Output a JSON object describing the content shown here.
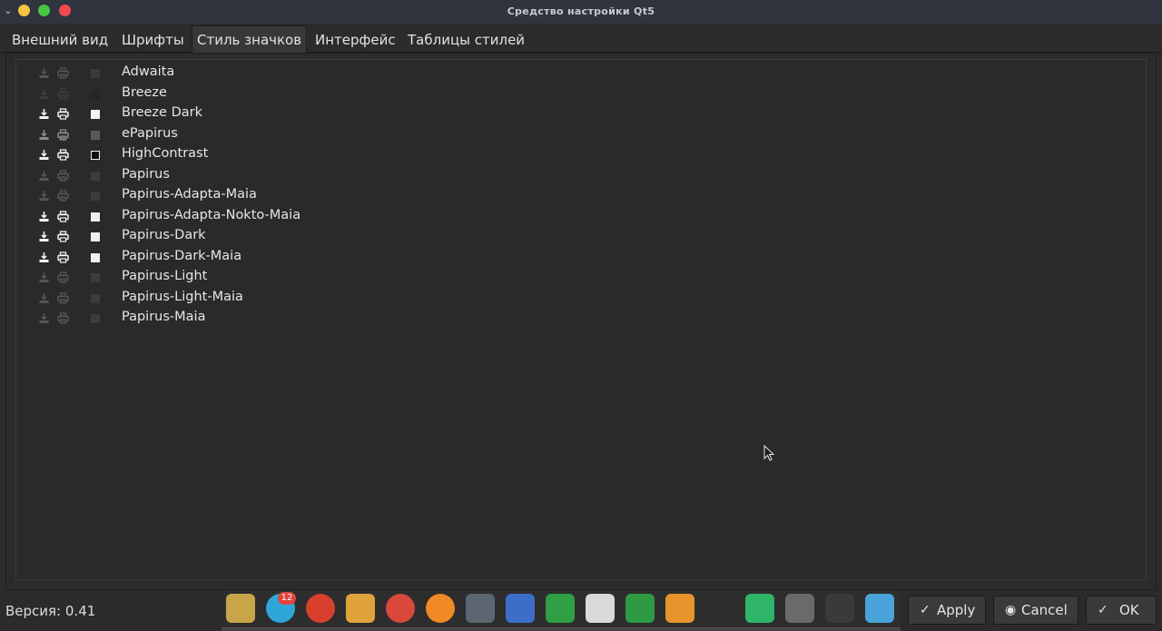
{
  "window": {
    "title": "Средство настройки Qt5"
  },
  "tabs": [
    {
      "label": "Внешний вид"
    },
    {
      "label": "Шрифты"
    },
    {
      "label": "Стиль значков"
    },
    {
      "label": "Интерфейс"
    },
    {
      "label": "Таблицы стилей"
    }
  ],
  "active_tab": "Стиль значков",
  "themes": [
    {
      "name": "Adwaita",
      "icon_style": "dim",
      "swatch": "#3a3a3a"
    },
    {
      "name": "Breeze",
      "icon_style": "dark",
      "swatch": "#232629"
    },
    {
      "name": "Breeze Dark",
      "icon_style": "light",
      "swatch": "#f4f4f4"
    },
    {
      "name": "ePapirus",
      "icon_style": "grey",
      "swatch": "#5a5a5a"
    },
    {
      "name": "HighContrast",
      "icon_style": "light",
      "swatch": "outline"
    },
    {
      "name": "Papirus",
      "icon_style": "dim",
      "swatch": "#3c3c3c"
    },
    {
      "name": "Papirus-Adapta-Maia",
      "icon_style": "dim",
      "swatch": "#3c3c3c"
    },
    {
      "name": "Papirus-Adapta-Nokto-Maia",
      "icon_style": "light",
      "swatch": "#eeeeee"
    },
    {
      "name": "Papirus-Dark",
      "icon_style": "light",
      "swatch": "#eeeeee"
    },
    {
      "name": "Papirus-Dark-Maia",
      "icon_style": "light",
      "swatch": "#eeeeee"
    },
    {
      "name": "Papirus-Light",
      "icon_style": "dim",
      "swatch": "#3c3c3c"
    },
    {
      "name": "Papirus-Light-Maia",
      "icon_style": "dim",
      "swatch": "#3c3c3c"
    },
    {
      "name": "Papirus-Maia",
      "icon_style": "dim",
      "swatch": "#3c3c3c"
    }
  ],
  "footer": {
    "version": "Версия: 0.41",
    "apply_label": "Apply",
    "cancel_label": "Cancel",
    "ok_label": "OK"
  },
  "dock": {
    "telegram_badge": "12",
    "apps": [
      {
        "name": "archive-manager-icon",
        "color": "#c9a54a"
      },
      {
        "name": "telegram-icon",
        "color": "#2ea6da"
      },
      {
        "name": "doublecmd-icon",
        "color": "#d8402d"
      },
      {
        "name": "bleachbit-icon",
        "color": "#e0a23a"
      },
      {
        "name": "stacer-icon",
        "color": "#d9483b"
      },
      {
        "name": "firefox-icon",
        "color": "#f08a24"
      },
      {
        "name": "calculator-icon",
        "color": "#5c6670"
      },
      {
        "name": "writer-icon",
        "color": "#3c6ec8"
      },
      {
        "name": "calc-icon",
        "color": "#2f9e44"
      },
      {
        "name": "pdf-icon",
        "color": "#d9d9d9"
      },
      {
        "name": "vim-icon",
        "color": "#2e9a44"
      },
      {
        "name": "sublime-text-icon",
        "color": "#e8932c"
      },
      {
        "name": "pycharm-icon",
        "color": "#2d2d2d"
      },
      {
        "name": "system-monitor-icon",
        "color": "#2fb56a"
      },
      {
        "name": "trash-icon",
        "color": "#6a6a6a"
      },
      {
        "name": "terminal-icon",
        "color": "#3a3a3a"
      },
      {
        "name": "file-manager-icon",
        "color": "#4aa3d8"
      }
    ]
  },
  "colors": {
    "background": "#2b2b2b",
    "titlebar": "#2f343f",
    "text": "#e4e4e4"
  }
}
